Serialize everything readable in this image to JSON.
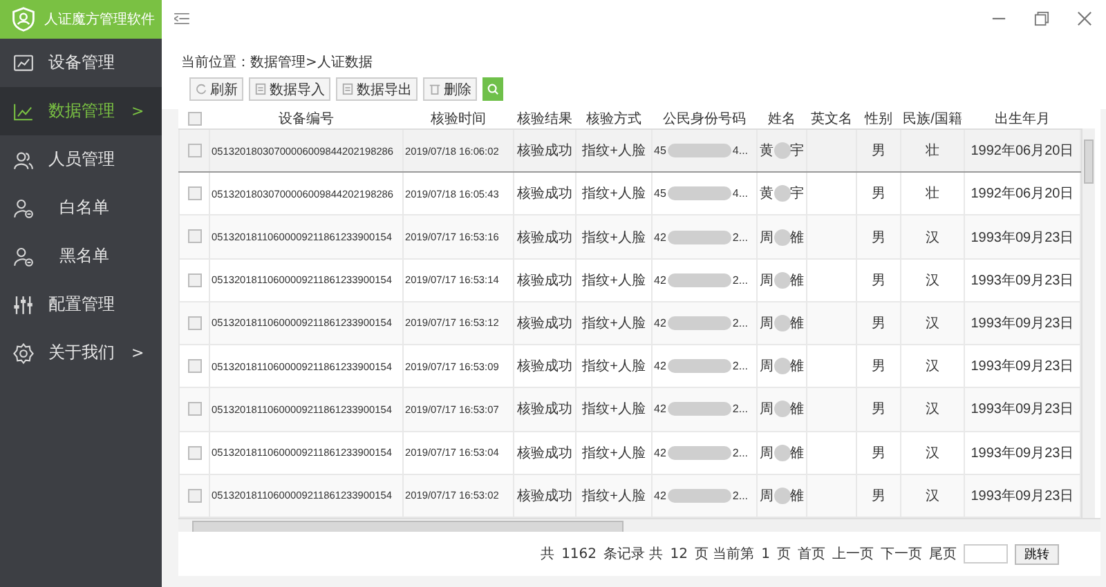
{
  "app": {
    "title": "人证魔方管理软件"
  },
  "sidebar": {
    "items": [
      {
        "label": "设备管理",
        "selected": false
      },
      {
        "label": "数据管理",
        "selected": true,
        "arrow": ">"
      },
      {
        "label": "人员管理",
        "selected": false,
        "children": [
          {
            "label": "白名单",
            "selected": false
          },
          {
            "label": "黑名单",
            "selected": false
          }
        ]
      },
      {
        "label": "配置管理",
        "selected": false
      },
      {
        "label": "关于我们",
        "selected": false,
        "arrow": ">"
      }
    ]
  },
  "breadcrumb": "当前位置：数据管理>人证数据",
  "toolbar": [
    {
      "kind": "button",
      "label": "刷新"
    },
    {
      "kind": "button",
      "label": "数据导入"
    },
    {
      "kind": "button",
      "label": "数据导出"
    },
    {
      "kind": "button",
      "label": "删除"
    },
    {
      "kind": "search"
    }
  ],
  "table": {
    "select_all_checked": false,
    "columns": [
      "设备编号",
      "核验时间",
      "核验结果",
      "核验方式",
      "公民身份号码",
      "姓名",
      "英文名",
      "性别",
      "民族/国籍",
      "出生年月"
    ],
    "rows": [
      {
        "selected": true,
        "checked": false,
        "device": "05132018030700006009844202198286",
        "time": "2019/07/18 16:06:02",
        "result": "核验成功",
        "method": "指纹+人脸",
        "id_start": "45",
        "id_end": "4...",
        "name_start": "黄",
        "name_end": "宇",
        "sex": "男",
        "ethnicity": "壮",
        "birth": "1992年06月20日"
      },
      {
        "selected": false,
        "checked": false,
        "device": "05132018030700006009844202198286",
        "time": "2019/07/18 16:05:43",
        "result": "核验成功",
        "method": "指纹+人脸",
        "id_start": "45",
        "id_end": "4...",
        "name_start": "黄",
        "name_end": "宇",
        "sex": "男",
        "ethnicity": "壮",
        "birth": "1992年06月20日"
      },
      {
        "selected": false,
        "checked": false,
        "device": "05132018110600009211861233900154",
        "time": "2019/07/17 16:53:16",
        "result": "核验成功",
        "method": "指纹+人脸",
        "id_start": "42",
        "id_end": "2...",
        "name_start": "周",
        "name_end": "雒",
        "sex": "男",
        "ethnicity": "汉",
        "birth": "1993年09月23日"
      },
      {
        "selected": false,
        "checked": false,
        "device": "05132018110600009211861233900154",
        "time": "2019/07/17 16:53:14",
        "result": "核验成功",
        "method": "指纹+人脸",
        "id_start": "42",
        "id_end": "2...",
        "name_start": "周",
        "name_end": "雒",
        "sex": "男",
        "ethnicity": "汉",
        "birth": "1993年09月23日"
      },
      {
        "selected": false,
        "checked": false,
        "device": "05132018110600009211861233900154",
        "time": "2019/07/17 16:53:12",
        "result": "核验成功",
        "method": "指纹+人脸",
        "id_start": "42",
        "id_end": "2...",
        "name_start": "周",
        "name_end": "雒",
        "sex": "男",
        "ethnicity": "汉",
        "birth": "1993年09月23日"
      },
      {
        "selected": false,
        "checked": false,
        "device": "05132018110600009211861233900154",
        "time": "2019/07/17 16:53:09",
        "result": "核验成功",
        "method": "指纹+人脸",
        "id_start": "42",
        "id_end": "2...",
        "name_start": "周",
        "name_end": "雒",
        "sex": "男",
        "ethnicity": "汉",
        "birth": "1993年09月23日"
      },
      {
        "selected": false,
        "checked": false,
        "device": "05132018110600009211861233900154",
        "time": "2019/07/17 16:53:07",
        "result": "核验成功",
        "method": "指纹+人脸",
        "id_start": "42",
        "id_end": "2...",
        "name_start": "周",
        "name_end": "雒",
        "sex": "男",
        "ethnicity": "汉",
        "birth": "1993年09月23日"
      },
      {
        "selected": false,
        "checked": false,
        "device": "05132018110600009211861233900154",
        "time": "2019/07/17 16:53:04",
        "result": "核验成功",
        "method": "指纹+人脸",
        "id_start": "42",
        "id_end": "2...",
        "name_start": "周",
        "name_end": "雒",
        "sex": "男",
        "ethnicity": "汉",
        "birth": "1993年09月23日"
      },
      {
        "selected": false,
        "checked": false,
        "device": "05132018110600009211861233900154",
        "time": "2019/07/17 16:53:02",
        "result": "核验成功",
        "method": "指纹+人脸",
        "id_start": "42",
        "id_end": "2...",
        "name_start": "周",
        "name_end": "雒",
        "sex": "男",
        "ethnicity": "汉",
        "birth": "1993年09月23日"
      }
    ]
  },
  "pager": {
    "total_prefix": "共",
    "total": "1162",
    "records_label": "条记录 共",
    "pages": "12",
    "pages_label": "页 当前第",
    "current": "1",
    "current_label": "页",
    "links": [
      "首页",
      "上一页",
      "下一页",
      "尾页"
    ],
    "jump_button": "跳转"
  }
}
